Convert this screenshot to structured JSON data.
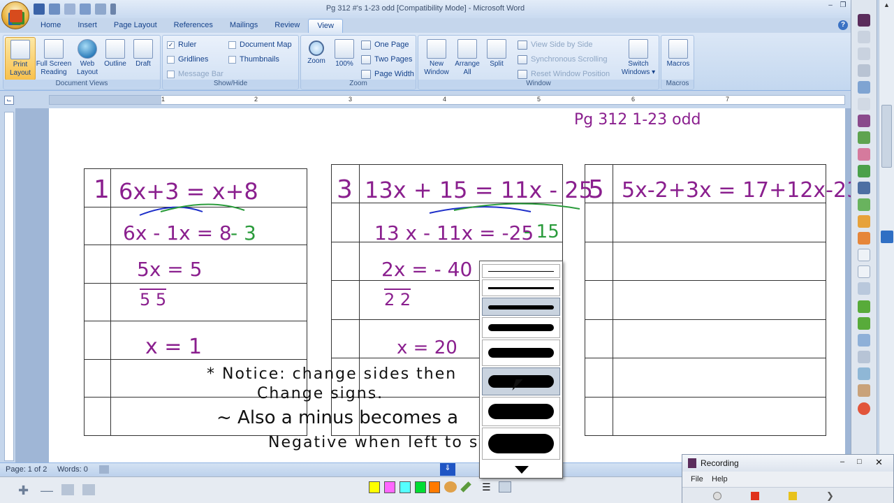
{
  "window": {
    "title": "Pg 312 #'s 1-23 odd [Compatibility Mode] - Microsoft Word",
    "help": "?"
  },
  "tabs": [
    "Home",
    "Insert",
    "Page Layout",
    "References",
    "Mailings",
    "Review",
    "View"
  ],
  "ribbon": {
    "document_views": {
      "label": "Document Views",
      "print_layout": [
        "Print",
        "Layout"
      ],
      "full_screen": [
        "Full Screen",
        "Reading"
      ],
      "web_layout": [
        "Web",
        "Layout"
      ],
      "outline": "Outline",
      "draft": "Draft"
    },
    "show_hide": {
      "label": "Show/Hide",
      "ruler": "Ruler",
      "gridlines": "Gridlines",
      "message_bar": "Message Bar",
      "document_map": "Document Map",
      "thumbnails": "Thumbnails"
    },
    "zoom": {
      "label": "Zoom",
      "zoom": "Zoom",
      "hundred": "100%",
      "one_page": "One Page",
      "two_pages": "Two Pages",
      "page_width": "Page Width"
    },
    "window": {
      "label": "Window",
      "new_window": [
        "New",
        "Window"
      ],
      "arrange_all": [
        "Arrange",
        "All"
      ],
      "split": "Split",
      "view_side": "View Side by Side",
      "sync_scroll": "Synchronous Scrolling",
      "reset_pos": "Reset Window Position",
      "switch_windows": [
        "Switch",
        "Windows ▾"
      ]
    },
    "macros": {
      "label": "Macros",
      "macros": "Macros"
    }
  },
  "ruler": {
    "numbers": [
      "1",
      "2",
      "3",
      "4",
      "5",
      "6",
      "7"
    ]
  },
  "document": {
    "header_note": "Pg 312    1-23 odd",
    "problem1": {
      "num": "1",
      "eq": "6x+3 = x+8",
      "step1": "6x - 1x = 8",
      "step1b": "- 3",
      "step2": "5x = 5",
      "step2b": "5      5",
      "answer": "x = 1"
    },
    "problem3": {
      "num": "3",
      "eq": "13x + 15 = 11x - 25",
      "step1": "13 x - 11x = -25",
      "step1b": "- 15",
      "step2": "2x = - 40",
      "step2b": "2      2",
      "answer": "x = 20"
    },
    "problem5": {
      "num": "5",
      "eq": "5x-2+3x = 17+12x-23"
    },
    "note1": "* Notice: change sides then",
    "note1b": "Change signs.",
    "note2": "~ Also a minus becomes a",
    "note2b": "Negative when left to start."
  },
  "statusbar": {
    "page": "Page: 1 of 2",
    "words": "Words: 0"
  },
  "recording": {
    "title": "Recording",
    "menu": [
      "File",
      "Help"
    ]
  },
  "colors": {
    "ink_purple": "#8a1f8e",
    "ink_green": "#2a9b3b",
    "ink_blue": "#1d2ec9",
    "ribbon_active": "#f8c14d"
  }
}
